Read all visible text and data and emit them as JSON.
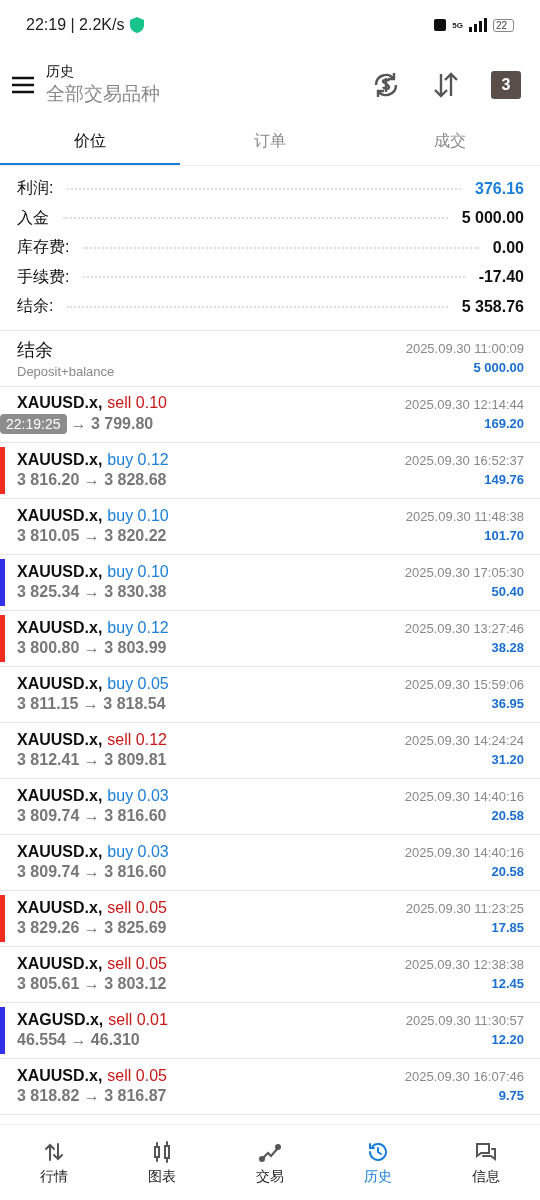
{
  "status_bar": {
    "time": "22:19 | 2.2K/s",
    "network": "5G",
    "battery": "22"
  },
  "header": {
    "title": "历史",
    "subtitle": "全部交易品种",
    "calendar_day": "3"
  },
  "tabs": [
    {
      "label": "价位",
      "selected": true
    },
    {
      "label": "订单",
      "selected": false
    },
    {
      "label": "成交",
      "selected": false
    }
  ],
  "summary": [
    {
      "label": "利润:",
      "value": "376.16",
      "kind": "profit"
    },
    {
      "label": "入金",
      "value": "5 000.00",
      "kind": "plain"
    },
    {
      "label": "库存费:",
      "value": "0.00",
      "kind": "plain"
    },
    {
      "label": "手续费:",
      "value": "-17.40",
      "kind": "plain"
    },
    {
      "label": "结余:",
      "value": "5 358.76",
      "kind": "plain"
    }
  ],
  "balance_entry": {
    "title": "结余",
    "comment": "Deposit+balance",
    "time": "2025.09.30 11:00:09",
    "amount": "5 000.00"
  },
  "overlay_clock": "22:19:25",
  "trades": [
    {
      "symbol": "XAUUSD.x,",
      "kind": "sell",
      "action": "sell 0.10",
      "prices": "→ 3 799.80",
      "time": "2025.09.30 12:14:44",
      "profit": "169.20"
    },
    {
      "symbol": "XAUUSD.x,",
      "kind": "buy",
      "action": "buy 0.12",
      "prices": "3 816.20 → 3 828.68",
      "time": "2025.09.30 16:52:37",
      "profit": "149.76",
      "color": "#f02c1c"
    },
    {
      "symbol": "XAUUSD.x,",
      "kind": "buy",
      "action": "buy 0.10",
      "prices": "3 810.05 → 3 820.22",
      "time": "2025.09.30 11:48:38",
      "profit": "101.70"
    },
    {
      "symbol": "XAUUSD.x,",
      "kind": "buy",
      "action": "buy 0.10",
      "prices": "3 825.34 → 3 830.38",
      "time": "2025.09.30 17:05:30",
      "profit": "50.40",
      "color": "#3030e8"
    },
    {
      "symbol": "XAUUSD.x,",
      "kind": "buy",
      "action": "buy 0.12",
      "prices": "3 800.80 → 3 803.99",
      "time": "2025.09.30 13:27:46",
      "profit": "38.28",
      "color": "#f02c1c"
    },
    {
      "symbol": "XAUUSD.x,",
      "kind": "buy",
      "action": "buy 0.05",
      "prices": "3 811.15 → 3 818.54",
      "time": "2025.09.30 15:59:06",
      "profit": "36.95"
    },
    {
      "symbol": "XAUUSD.x,",
      "kind": "sell",
      "action": "sell 0.12",
      "prices": "3 812.41 → 3 809.81",
      "time": "2025.09.30 14:24:24",
      "profit": "31.20"
    },
    {
      "symbol": "XAUUSD.x,",
      "kind": "buy",
      "action": "buy 0.03",
      "prices": "3 809.74 → 3 816.60",
      "time": "2025.09.30 14:40:16",
      "profit": "20.58"
    },
    {
      "symbol": "XAUUSD.x,",
      "kind": "buy",
      "action": "buy 0.03",
      "prices": "3 809.74 → 3 816.60",
      "time": "2025.09.30 14:40:16",
      "profit": "20.58"
    },
    {
      "symbol": "XAUUSD.x,",
      "kind": "sell",
      "action": "sell 0.05",
      "prices": "3 829.26 → 3 825.69",
      "time": "2025.09.30 11:23:25",
      "profit": "17.85",
      "color": "#f02c1c"
    },
    {
      "symbol": "XAUUSD.x,",
      "kind": "sell",
      "action": "sell 0.05",
      "prices": "3 805.61 → 3 803.12",
      "time": "2025.09.30 12:38:38",
      "profit": "12.45"
    },
    {
      "symbol": "XAGUSD.x,",
      "kind": "sell",
      "action": "sell 0.01",
      "prices": "46.554 → 46.310",
      "time": "2025.09.30 11:30:57",
      "profit": "12.20",
      "color": "#3030e8"
    },
    {
      "symbol": "XAUUSD.x,",
      "kind": "sell",
      "action": "sell 0.05",
      "prices": "3 818.82 → 3 816.87",
      "time": "2025.09.30 16:07:46",
      "profit": "9.75"
    }
  ],
  "nav": [
    {
      "label": "行情",
      "kind": "quotes",
      "selected": false
    },
    {
      "label": "图表",
      "kind": "chart",
      "selected": false
    },
    {
      "label": "交易",
      "kind": "trade",
      "selected": false
    },
    {
      "label": "历史",
      "kind": "history",
      "selected": true
    },
    {
      "label": "信息",
      "kind": "messages",
      "selected": false
    }
  ]
}
